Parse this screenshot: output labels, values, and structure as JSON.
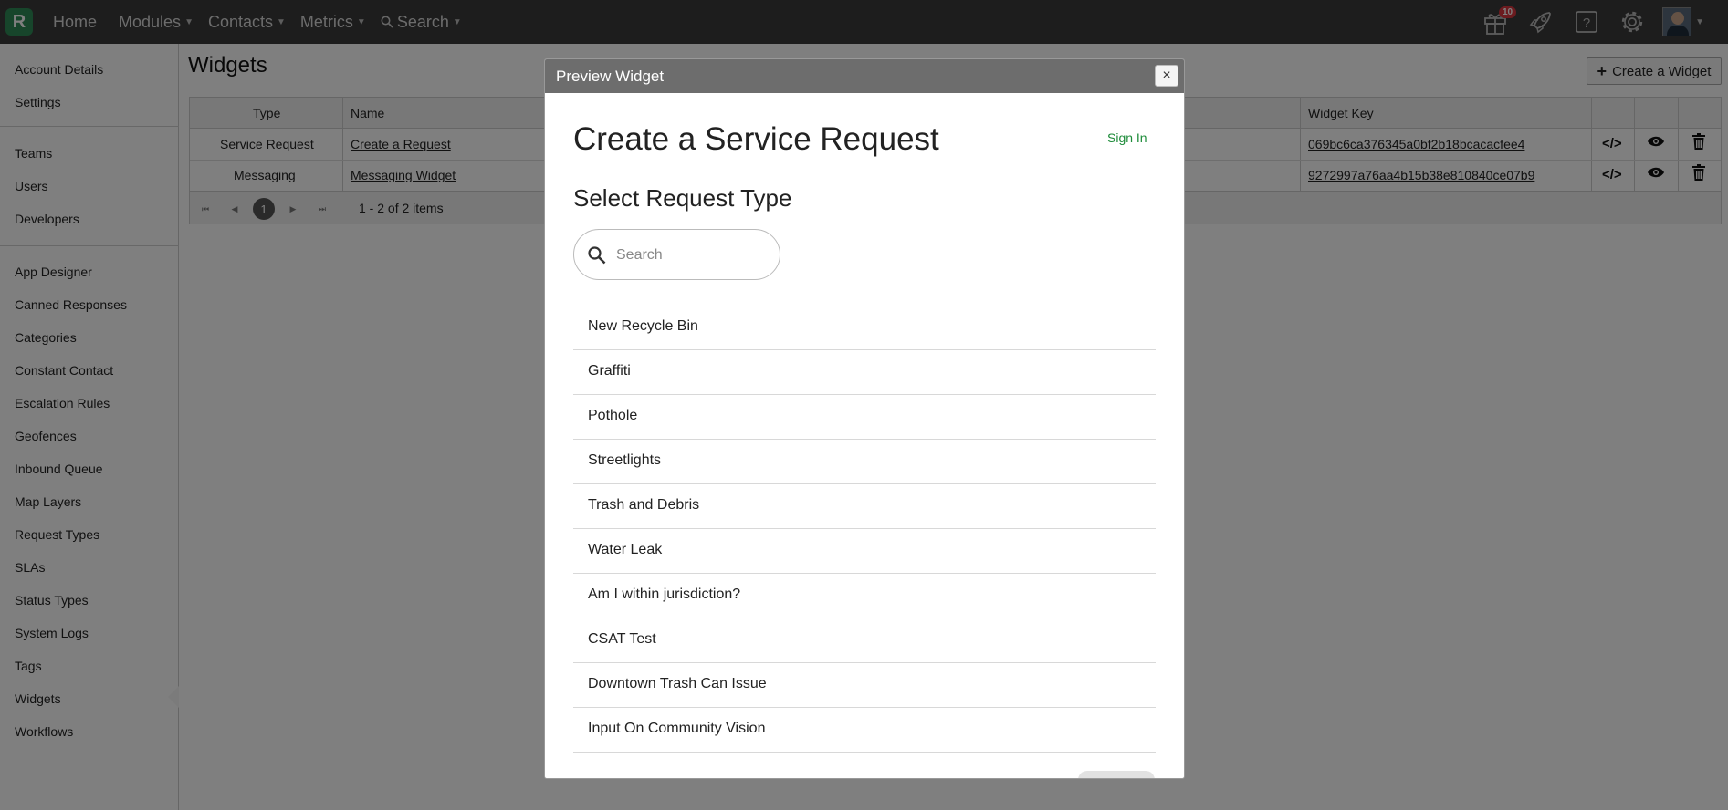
{
  "topbar": {
    "logo_letter": "R",
    "nav": [
      "Home",
      "Modules",
      "Contacts",
      "Metrics",
      "Search"
    ],
    "gift_badge": "10",
    "icons": [
      "gift-icon",
      "rocket-icon",
      "help-icon",
      "gear-icon",
      "avatar"
    ]
  },
  "sidebar": {
    "group1": [
      "Account Details",
      "Settings"
    ],
    "group2": [
      "Teams",
      "Users",
      "Developers"
    ],
    "group3": [
      "App Designer",
      "Canned Responses",
      "Categories",
      "Constant Contact",
      "Escalation Rules",
      "Geofences",
      "Inbound Queue",
      "Map Layers",
      "Request Types",
      "SLAs",
      "Status Types",
      "System Logs",
      "Tags",
      "Widgets",
      "Workflows"
    ],
    "active": "Widgets"
  },
  "main": {
    "title": "Widgets",
    "create_label": "Create a Widget",
    "columns": {
      "type": "Type",
      "name": "Name",
      "key": "Widget Key"
    },
    "rows": [
      {
        "type": "Service Request",
        "name": "Create a Request",
        "key": "069bc6ca376345a0bf2b18bcacacfee4"
      },
      {
        "type": "Messaging",
        "name": "Messaging Widget",
        "key": "9272997a76aa4b15b38e810840ce07b9"
      }
    ],
    "pager": {
      "current_page": "1",
      "summary": "1 - 2 of 2 items"
    }
  },
  "modal": {
    "title": "Preview Widget",
    "close": "×",
    "heading": "Create a Service Request",
    "sign_in": "Sign In",
    "subheading": "Select Request Type",
    "search_placeholder": "Search",
    "request_types": [
      "New Recycle Bin",
      "Graffiti",
      "Pothole",
      "Streetlights",
      "Trash and Debris",
      "Water Leak",
      "Am I within jurisdiction?",
      "CSAT Test",
      "Downtown Trash Can Issue",
      "Input On Community Vision"
    ]
  },
  "colors": {
    "topbar": "#3a3a3a",
    "brand_green": "#2e8b57",
    "sign_in": "#1e8c3a",
    "modal_header": "#6d6d6d"
  }
}
